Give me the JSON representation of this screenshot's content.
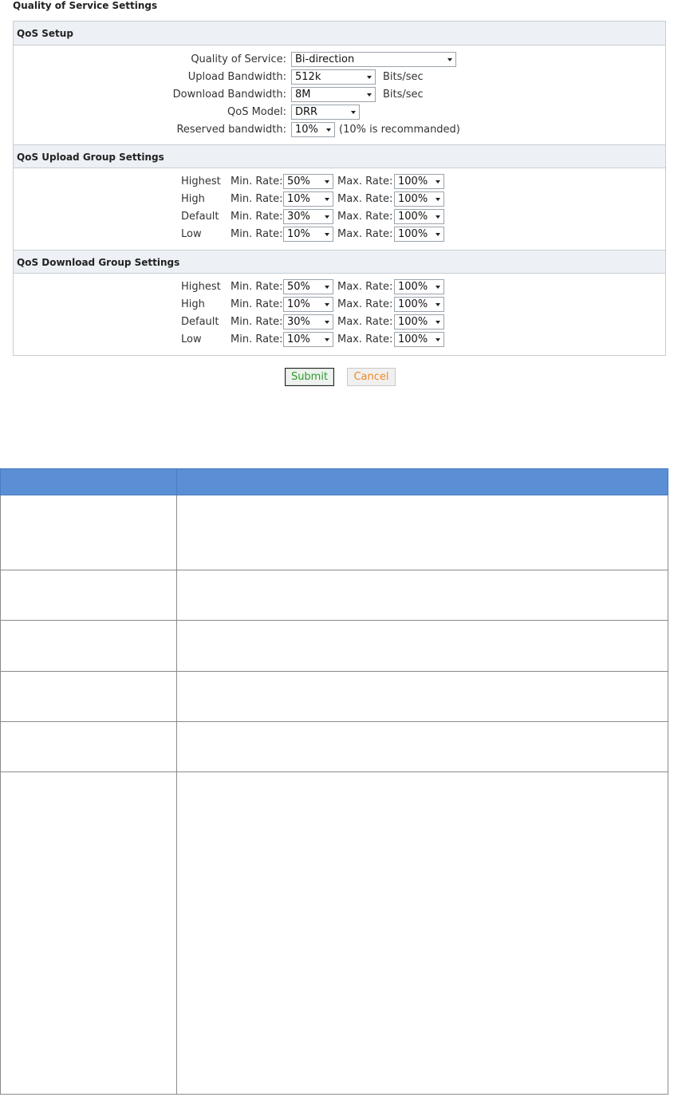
{
  "page_title": "Quality of Service Settings",
  "qos_setup": {
    "heading": "QoS Setup",
    "quality_of_service": {
      "label": "Quality of Service:",
      "value": "Bi-direction"
    },
    "upload_bandwidth": {
      "label": "Upload Bandwidth:",
      "value": "512k",
      "unit": "Bits/sec"
    },
    "download_bandwidth": {
      "label": "Download Bandwidth:",
      "value": "8M",
      "unit": "Bits/sec"
    },
    "qos_model": {
      "label": "QoS Model:",
      "value": "DRR"
    },
    "reserved_bandwidth": {
      "label": "Reserved bandwidth:",
      "value": "10%",
      "note": "(10% is recommanded)"
    }
  },
  "rate_labels": {
    "min": "Min. Rate:",
    "max": "Max. Rate:"
  },
  "upload_groups": {
    "heading": "QoS Upload Group Settings",
    "rows": [
      {
        "name": "Highest",
        "min": "50%",
        "max": "100%"
      },
      {
        "name": "High",
        "min": "10%",
        "max": "100%"
      },
      {
        "name": "Default",
        "min": "30%",
        "max": "100%"
      },
      {
        "name": "Low",
        "min": "10%",
        "max": "100%"
      }
    ]
  },
  "download_groups": {
    "heading": "QoS Download Group Settings",
    "rows": [
      {
        "name": "Highest",
        "min": "50%",
        "max": "100%"
      },
      {
        "name": "High",
        "min": "10%",
        "max": "100%"
      },
      {
        "name": "Default",
        "min": "30%",
        "max": "100%"
      },
      {
        "name": "Low",
        "min": "10%",
        "max": "100%"
      }
    ]
  },
  "buttons": {
    "submit": "Submit",
    "cancel": "Cancel"
  },
  "colors": {
    "table_header": "#5a8fd6",
    "panel_header": "#edf1f5",
    "submit_text": "#2e9b2e",
    "cancel_text": "#ee8a22"
  }
}
